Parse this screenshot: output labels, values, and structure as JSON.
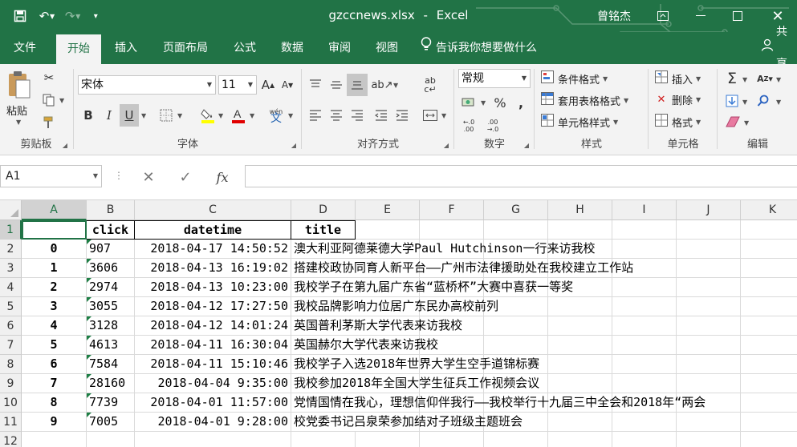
{
  "titlebar": {
    "file_name": "gzccnews.xlsx",
    "separator": "-",
    "app_name": "Excel",
    "user_name": "曾铭杰"
  },
  "tabs": [
    {
      "label": "文件",
      "active": false
    },
    {
      "label": "开始",
      "active": true
    },
    {
      "label": "插入",
      "active": false
    },
    {
      "label": "页面布局",
      "active": false
    },
    {
      "label": "公式",
      "active": false
    },
    {
      "label": "数据",
      "active": false
    },
    {
      "label": "审阅",
      "active": false
    },
    {
      "label": "视图",
      "active": false
    }
  ],
  "tell_me": "告诉我你想要做什么",
  "share": "共享",
  "ribbon": {
    "clipboard": {
      "label": "剪贴板",
      "paste": "粘贴"
    },
    "font": {
      "label": "字体",
      "font_name": "宋体",
      "font_size": "11",
      "bold": "B",
      "italic": "I",
      "underline": "U",
      "wen": "wén"
    },
    "alignment": {
      "label": "对齐方式"
    },
    "number": {
      "label": "数字",
      "format": "常规",
      "percent": "%"
    },
    "styles": {
      "label": "样式",
      "conditional": "条件格式",
      "table_format": "套用表格格式",
      "cell_styles": "单元格样式"
    },
    "cells": {
      "label": "单元格",
      "insert": "插入",
      "delete": "删除",
      "format": "格式"
    },
    "editing": {
      "label": "编辑"
    }
  },
  "formula_bar": {
    "name_box": "A1",
    "fx": "fx",
    "value": ""
  },
  "columns": [
    "A",
    "B",
    "C",
    "D",
    "E",
    "F",
    "G",
    "H",
    "I",
    "J",
    "K"
  ],
  "row_numbers": [
    "1",
    "2",
    "3",
    "4",
    "5",
    "6",
    "7",
    "8",
    "9",
    "10",
    "11",
    "12"
  ],
  "header_row": {
    "a": "",
    "b": "click",
    "c": "datetime",
    "d": "title"
  },
  "rows": [
    {
      "idx": "0",
      "click": "907",
      "datetime": "2018-04-17 14:50:52",
      "title": "澳大利亚阿德莱德大学Paul Hutchinson一行来访我校"
    },
    {
      "idx": "1",
      "click": "3606",
      "datetime": "2018-04-13 16:19:02",
      "title": "搭建校政协同育人新平台——广州市法律援助处在我校建立工作站"
    },
    {
      "idx": "2",
      "click": "2974",
      "datetime": "2018-04-13 10:23:00",
      "title": "我校学子在第九届广东省“蓝桥杯”大赛中喜获一等奖"
    },
    {
      "idx": "3",
      "click": "3055",
      "datetime": "2018-04-12 17:27:50",
      "title": "我校品牌影响力位居广东民办高校前列"
    },
    {
      "idx": "4",
      "click": "3128",
      "datetime": "2018-04-12 14:01:24",
      "title": "英国普利茅斯大学代表来访我校"
    },
    {
      "idx": "5",
      "click": "4613",
      "datetime": "2018-04-11 16:30:04",
      "title": "英国赫尔大学代表来访我校"
    },
    {
      "idx": "6",
      "click": "7584",
      "datetime": "2018-04-11 15:10:46",
      "title": "我校学子入选2018年世界大学生空手道锦标赛"
    },
    {
      "idx": "7",
      "click": "28160",
      "datetime": "2018-04-04 9:35:00",
      "title": "我校参加2018年全国大学生征兵工作视频会议"
    },
    {
      "idx": "8",
      "click": "7739",
      "datetime": "2018-04-01 11:57:00",
      "title": "党情国情在我心，理想信仰伴我行——我校举行十九届三中全会和2018年“两会"
    },
    {
      "idx": "9",
      "click": "7005",
      "datetime": "2018-04-01 9:28:00",
      "title": "校党委书记吕泉荣参加结对子班级主题班会"
    }
  ]
}
